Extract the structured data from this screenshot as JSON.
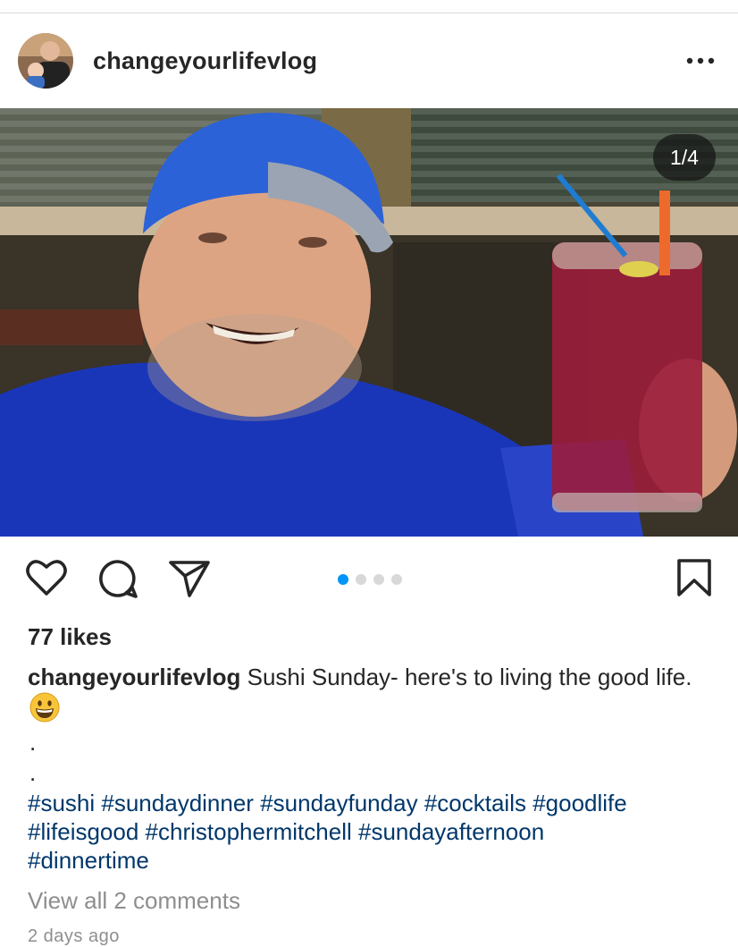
{
  "post": {
    "username": "changeyourlifevlog",
    "avatar_icon": "profile-avatar",
    "more_icon": "more-horizontal-icon"
  },
  "media": {
    "counter": "1/4",
    "current_index": 1,
    "total": 4,
    "description_icon": "post-photo"
  },
  "actions": {
    "icons": [
      "heart-icon",
      "comment-icon",
      "share-icon",
      "bookmark-icon"
    ],
    "accent_color": "#0095f6"
  },
  "likes": "77 likes",
  "caption": {
    "username": "changeyourlifevlog",
    "text": " Sushi Sunday- here's to living the good life.",
    "emoji_icon": "grinning-face-emoji",
    "dot_lines": [
      ".",
      "."
    ]
  },
  "hashtags": [
    "#sushi",
    "#sundaydinner",
    "#sundayfunday",
    "#cocktails",
    "#goodlife",
    "#lifeisgood",
    "#christophermitchell",
    "#sundayafternoon",
    "#dinnertime"
  ],
  "hashtag_color": "#00376b",
  "comments_link": "View all 2 comments",
  "timestamp": "2 days ago"
}
